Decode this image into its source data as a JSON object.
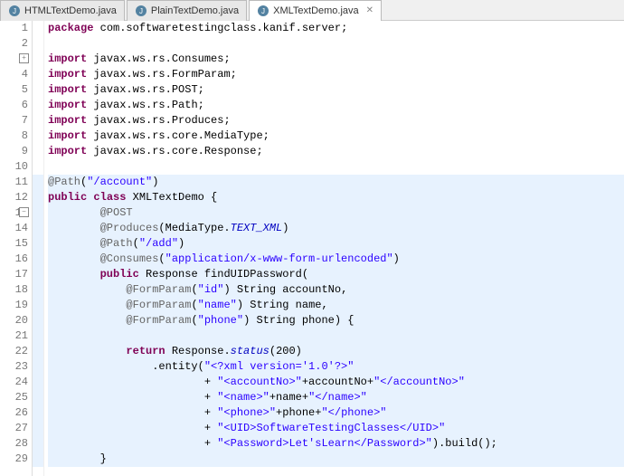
{
  "tabs": [
    {
      "label": "HTMLTextDemo.java",
      "active": false
    },
    {
      "label": "PlainTextDemo.java",
      "active": false
    },
    {
      "label": "XMLTextDemo.java",
      "active": true
    }
  ],
  "code": {
    "lines": [
      {
        "n": 1,
        "hl": false,
        "fold": "",
        "seg": [
          [
            "kw",
            "package"
          ],
          [
            "plain",
            " com.softwaretestingclass.kanif.server;"
          ]
        ]
      },
      {
        "n": 2,
        "hl": false,
        "fold": "",
        "seg": []
      },
      {
        "n": 3,
        "hl": false,
        "fold": "+",
        "seg": [
          [
            "kw",
            "import"
          ],
          [
            "plain",
            " javax.ws.rs.Consumes;"
          ]
        ]
      },
      {
        "n": 4,
        "hl": false,
        "fold": "",
        "seg": [
          [
            "kw",
            "import"
          ],
          [
            "plain",
            " javax.ws.rs.FormParam;"
          ]
        ]
      },
      {
        "n": 5,
        "hl": false,
        "fold": "",
        "seg": [
          [
            "kw",
            "import"
          ],
          [
            "plain",
            " javax.ws.rs.POST;"
          ]
        ]
      },
      {
        "n": 6,
        "hl": false,
        "fold": "",
        "seg": [
          [
            "kw",
            "import"
          ],
          [
            "plain",
            " javax.ws.rs.Path;"
          ]
        ]
      },
      {
        "n": 7,
        "hl": false,
        "fold": "",
        "seg": [
          [
            "kw",
            "import"
          ],
          [
            "plain",
            " javax.ws.rs.Produces;"
          ]
        ]
      },
      {
        "n": 8,
        "hl": false,
        "fold": "",
        "seg": [
          [
            "kw",
            "import"
          ],
          [
            "plain",
            " javax.ws.rs.core.MediaType;"
          ]
        ]
      },
      {
        "n": 9,
        "hl": false,
        "fold": "",
        "seg": [
          [
            "kw",
            "import"
          ],
          [
            "plain",
            " javax.ws.rs.core.Response;"
          ]
        ]
      },
      {
        "n": 10,
        "hl": false,
        "fold": "",
        "seg": []
      },
      {
        "n": 11,
        "hl": true,
        "fold": "",
        "seg": [
          [
            "ann",
            "@Path"
          ],
          [
            "plain",
            "("
          ],
          [
            "str",
            "\"/account\""
          ],
          [
            "plain",
            ")"
          ]
        ]
      },
      {
        "n": 12,
        "hl": true,
        "fold": "",
        "seg": [
          [
            "kw",
            "public"
          ],
          [
            "plain",
            " "
          ],
          [
            "kw",
            "class"
          ],
          [
            "plain",
            " XMLTextDemo {"
          ]
        ]
      },
      {
        "n": 13,
        "hl": true,
        "fold": "-",
        "seg": [
          [
            "plain",
            "        "
          ],
          [
            "ann",
            "@POST"
          ]
        ]
      },
      {
        "n": 14,
        "hl": true,
        "fold": "",
        "seg": [
          [
            "plain",
            "        "
          ],
          [
            "ann",
            "@Produces"
          ],
          [
            "plain",
            "(MediaType."
          ],
          [
            "it",
            "TEXT_XML"
          ],
          [
            "plain",
            ")"
          ]
        ]
      },
      {
        "n": 15,
        "hl": true,
        "fold": "",
        "seg": [
          [
            "plain",
            "        "
          ],
          [
            "ann",
            "@Path"
          ],
          [
            "plain",
            "("
          ],
          [
            "str",
            "\"/add\""
          ],
          [
            "plain",
            ")"
          ]
        ]
      },
      {
        "n": 16,
        "hl": true,
        "fold": "",
        "seg": [
          [
            "plain",
            "        "
          ],
          [
            "ann",
            "@Consumes"
          ],
          [
            "plain",
            "("
          ],
          [
            "str",
            "\"application/x-www-form-urlencoded\""
          ],
          [
            "plain",
            ")"
          ]
        ]
      },
      {
        "n": 17,
        "hl": true,
        "fold": "",
        "seg": [
          [
            "plain",
            "        "
          ],
          [
            "kw",
            "public"
          ],
          [
            "plain",
            " Response findUIDPassword("
          ]
        ]
      },
      {
        "n": 18,
        "hl": true,
        "fold": "",
        "seg": [
          [
            "plain",
            "            "
          ],
          [
            "ann",
            "@FormParam"
          ],
          [
            "plain",
            "("
          ],
          [
            "str",
            "\"id\""
          ],
          [
            "plain",
            ") String accountNo,"
          ]
        ]
      },
      {
        "n": 19,
        "hl": true,
        "fold": "",
        "seg": [
          [
            "plain",
            "            "
          ],
          [
            "ann",
            "@FormParam"
          ],
          [
            "plain",
            "("
          ],
          [
            "str",
            "\"name\""
          ],
          [
            "plain",
            ") String name,"
          ]
        ]
      },
      {
        "n": 20,
        "hl": true,
        "fold": "",
        "seg": [
          [
            "plain",
            "            "
          ],
          [
            "ann",
            "@FormParam"
          ],
          [
            "plain",
            "("
          ],
          [
            "str",
            "\"phone\""
          ],
          [
            "plain",
            ") String phone) {"
          ]
        ]
      },
      {
        "n": 21,
        "hl": true,
        "fold": "",
        "seg": []
      },
      {
        "n": 22,
        "hl": true,
        "fold": "",
        "seg": [
          [
            "plain",
            "            "
          ],
          [
            "kw",
            "return"
          ],
          [
            "plain",
            " Response."
          ],
          [
            "it",
            "status"
          ],
          [
            "plain",
            "(200)"
          ]
        ]
      },
      {
        "n": 23,
        "hl": true,
        "fold": "",
        "seg": [
          [
            "plain",
            "                .entity("
          ],
          [
            "str",
            "\"<?xml version='1.0'?>\""
          ]
        ]
      },
      {
        "n": 24,
        "hl": true,
        "fold": "",
        "seg": [
          [
            "plain",
            "                        + "
          ],
          [
            "str",
            "\"<accountNo>\""
          ],
          [
            "plain",
            "+accountNo+"
          ],
          [
            "str",
            "\"</accountNo>\""
          ]
        ]
      },
      {
        "n": 25,
        "hl": true,
        "fold": "",
        "seg": [
          [
            "plain",
            "                        + "
          ],
          [
            "str",
            "\"<name>\""
          ],
          [
            "plain",
            "+name+"
          ],
          [
            "str",
            "\"</name>\""
          ]
        ]
      },
      {
        "n": 26,
        "hl": true,
        "fold": "",
        "seg": [
          [
            "plain",
            "                        + "
          ],
          [
            "str",
            "\"<phone>\""
          ],
          [
            "plain",
            "+phone+"
          ],
          [
            "str",
            "\"</phone>\""
          ]
        ]
      },
      {
        "n": 27,
        "hl": true,
        "fold": "",
        "seg": [
          [
            "plain",
            "                        + "
          ],
          [
            "str",
            "\"<UID>SoftwareTestingClasses</UID>\""
          ]
        ]
      },
      {
        "n": 28,
        "hl": true,
        "fold": "",
        "seg": [
          [
            "plain",
            "                        + "
          ],
          [
            "str",
            "\"<Password>Let'sLearn</Password>\""
          ],
          [
            "plain",
            ").build();"
          ]
        ]
      },
      {
        "n": 29,
        "hl": true,
        "fold": "",
        "seg": [
          [
            "plain",
            "        }"
          ]
        ]
      }
    ]
  }
}
